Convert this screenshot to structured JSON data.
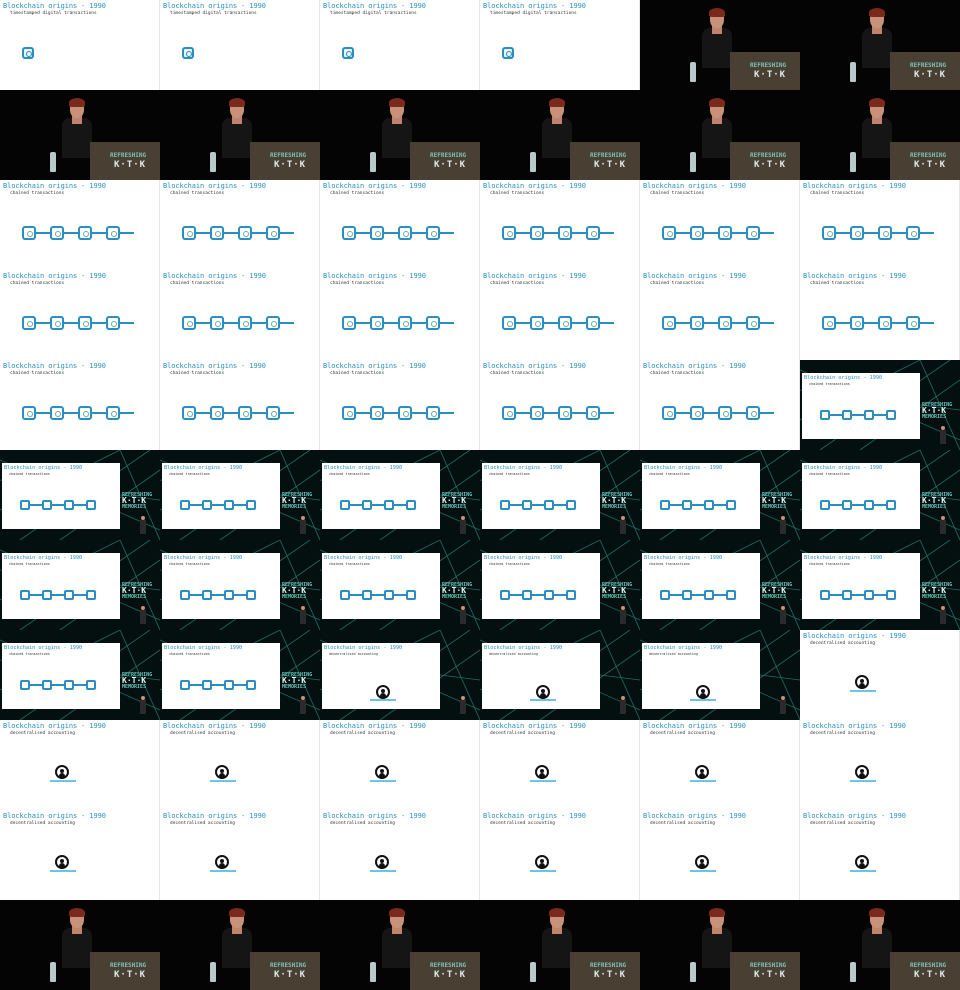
{
  "slides": {
    "title": "Blockchain origins - 1990",
    "subtitle_timestamp": "timestamped digital transactions",
    "subtitle_chain": "chained transactions",
    "subtitle_decentral": "decentralised accounting"
  },
  "branding": {
    "podium_line1": "REFRESHING",
    "podium_line2": "K·T·K",
    "side_line1": "REFRESHING",
    "side_line2": "K·T·K",
    "side_line3": "MEMORIES"
  },
  "grid": {
    "columns": 6,
    "rows": 11,
    "cells": [
      "stamp",
      "stamp",
      "stamp",
      "stamp",
      "talk",
      "talk",
      "talk",
      "talk",
      "talk",
      "talk",
      "talk",
      "talk",
      "chain",
      "chain",
      "chain",
      "chain",
      "chain",
      "chain",
      "chain",
      "chain",
      "chain",
      "chain",
      "chain",
      "chain",
      "chain",
      "chain",
      "chain",
      "chain",
      "chain",
      "overlay-chain",
      "overlay-chain",
      "overlay-chain",
      "overlay-chain",
      "overlay-chain",
      "overlay-chain",
      "overlay-chain",
      "overlay-chain",
      "overlay-chain",
      "overlay-chain",
      "overlay-chain",
      "overlay-chain",
      "overlay-chain",
      "overlay-chain",
      "overlay-chain",
      "overlay-decentral",
      "overlay-decentral",
      "overlay-decentral",
      "decentral",
      "decentral",
      "decentral",
      "decentral",
      "decentral",
      "decentral",
      "decentral",
      "decentral",
      "decentral",
      "decentral",
      "decentral",
      "decentral",
      "decentral",
      "talk",
      "talk",
      "talk",
      "talk",
      "talk",
      "talk"
    ]
  },
  "colors": {
    "accent": "#2a8fc0",
    "teal": "#68c6bf",
    "dark_bg": "#040404"
  }
}
